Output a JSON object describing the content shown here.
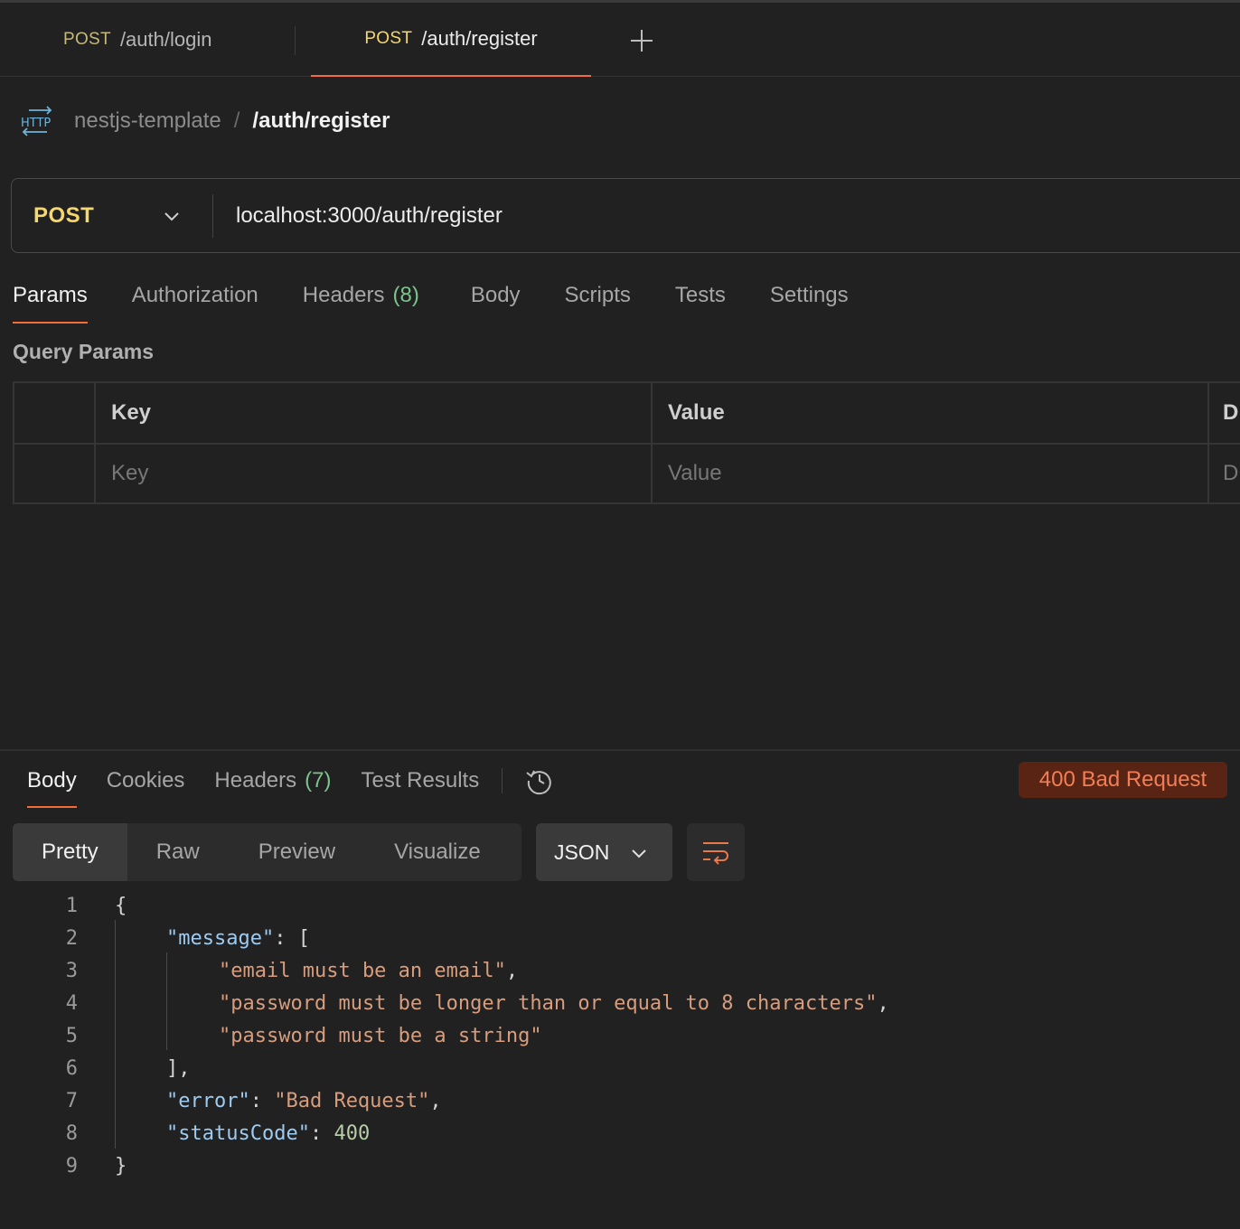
{
  "tabs": [
    {
      "method": "POST",
      "path": "/auth/login"
    },
    {
      "method": "POST",
      "path": "/auth/register"
    }
  ],
  "breadcrumb": {
    "icon": "http-icon",
    "collection": "nestjs-template",
    "separator": "/",
    "request": "/auth/register"
  },
  "url_bar": {
    "method": "POST",
    "url": "localhost:3000/auth/register"
  },
  "request_nav": {
    "params": "Params",
    "authorization": "Authorization",
    "headers": "Headers",
    "headers_count": "(8)",
    "body": "Body",
    "scripts": "Scripts",
    "tests": "Tests",
    "settings": "Settings"
  },
  "query_params": {
    "title": "Query Params",
    "columns": [
      "Key",
      "Value",
      "D"
    ],
    "placeholders": [
      "Key",
      "Value",
      "D"
    ]
  },
  "response_nav": {
    "body": "Body",
    "cookies": "Cookies",
    "headers": "Headers",
    "headers_count": "(7)",
    "test_results": "Test Results"
  },
  "status": {
    "text": "400 Bad Request",
    "color": "#f07f57",
    "background": "#5a2414"
  },
  "view_modes": {
    "pretty": "Pretty",
    "raw": "Raw",
    "preview": "Preview",
    "visualize": "Visualize"
  },
  "format": "JSON",
  "code": {
    "line_numbers": [
      "1",
      "2",
      "3",
      "4",
      "5",
      "6",
      "7",
      "8",
      "9"
    ],
    "open_brace": "{",
    "message_key": "\"message\"",
    "open_bracket": ": [",
    "msg1": "\"email must be an email\"",
    "msg2": "\"password must be longer than or equal to 8 characters\"",
    "msg3": "\"password must be a string\"",
    "close_bracket": "],",
    "error_key": "\"error\"",
    "error_value": "\"Bad Request\"",
    "status_key": "\"statusCode\"",
    "status_value": "400",
    "close_brace": "}"
  },
  "colors": {
    "accent": "#f26b3a",
    "method_yellow": "#f5d76e",
    "count_green": "#7cc48e"
  }
}
